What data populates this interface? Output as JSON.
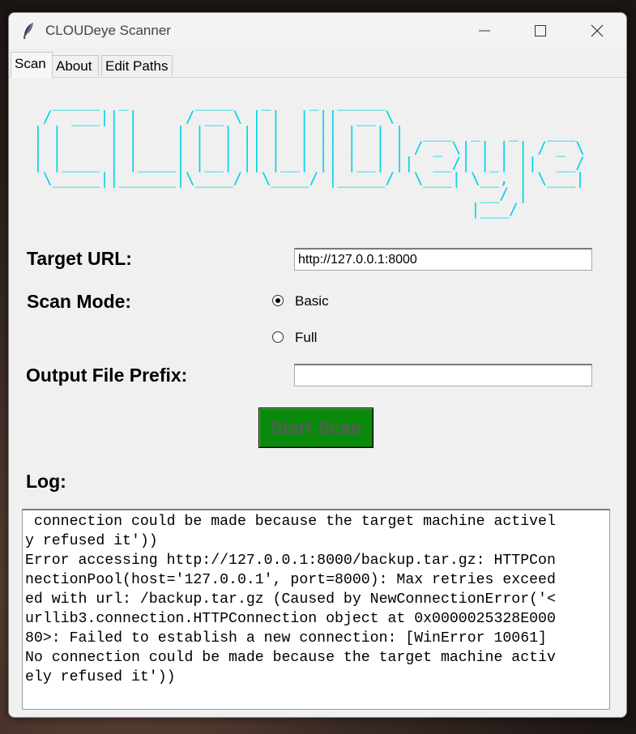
{
  "window": {
    "title": "CLOUDeye Scanner"
  },
  "tabs": [
    {
      "label": "Scan",
      "active": true
    },
    {
      "label": "About",
      "active": false
    },
    {
      "label": "Edit Paths",
      "active": false
    }
  ],
  "banner": {
    "ascii_art": "  _____  _       ____   _    _  _____  \n /  ___|| |     / __ \\ | |  | ||  __ \\\n| |     | |    | |  | || |  | || |  | |  ___  _   _   ___ \n| |     | |    | |  | || |  | || |  | | / _ \\| | | | / _ \\\n| |____ | |____| |__| || |__| || |__| ||  __/| |_| ||  __/\n \\_____||______|\\____/  \\____/ |_____/  \\___| \\__, | \\___|\n                                               __/ |\n                                              |___/ ",
    "color": "#00d4e6"
  },
  "form": {
    "target_url_label": "Target URL:",
    "target_url_value": "http://127.0.0.1:8000",
    "scan_mode_label": "Scan Mode:",
    "scan_mode_options": [
      {
        "label": "Basic",
        "selected": true
      },
      {
        "label": "Full",
        "selected": false
      }
    ],
    "output_prefix_label": "Output File Prefix:",
    "output_prefix_value": "",
    "start_button_label": "Start Scan",
    "start_button_color": "#0a8a0a"
  },
  "log": {
    "label": "Log:",
    "lines": [
      " connection could be made because the target machine activel",
      "y refused it'))",
      "Error accessing http://127.0.0.1:8000/backup.tar.gz: HTTPCon",
      "nectionPool(host='127.0.0.1', port=8000): Max retries exceed",
      "ed with url: /backup.tar.gz (Caused by NewConnectionError('<",
      "urllib3.connection.HTTPConnection object at 0x0000025328E000",
      "80>: Failed to establish a new connection: [WinError 10061]",
      "No connection could be made because the target machine activ",
      "ely refused it'))"
    ]
  }
}
